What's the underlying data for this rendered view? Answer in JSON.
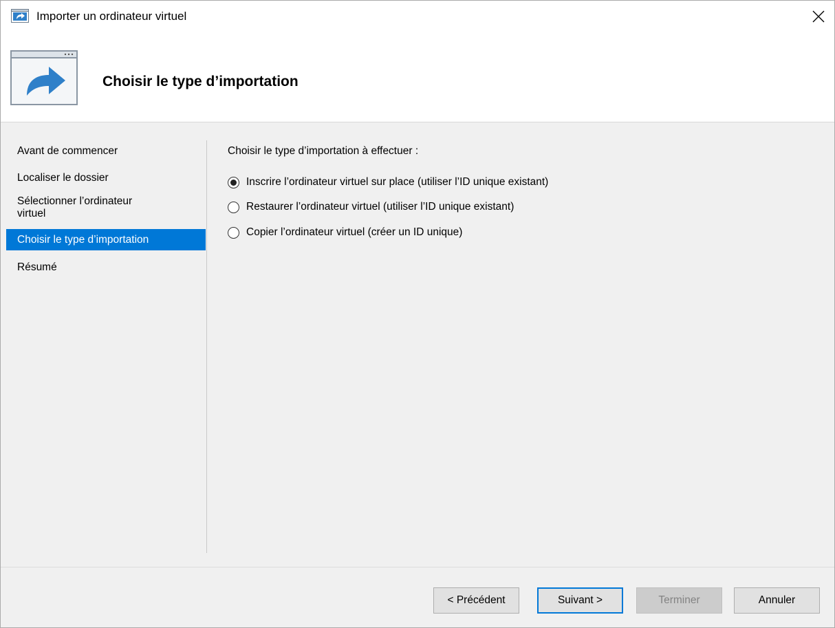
{
  "window": {
    "title": "Importer un ordinateur virtuel",
    "icon": "import-arrow-icon",
    "close_icon": "close-icon"
  },
  "header": {
    "title": "Choisir le type d’importation",
    "icon": "import-wizard-icon"
  },
  "nav": {
    "items": [
      {
        "label": "Avant de commencer",
        "active": false
      },
      {
        "label": "Localiser le dossier",
        "active": false
      },
      {
        "label_line1": "Sélectionner l’ordinateur",
        "label_line2": "virtuel",
        "active": false
      },
      {
        "label": "Choisir le type d’importation",
        "active": true
      },
      {
        "label": "Résumé",
        "active": false
      }
    ]
  },
  "content": {
    "prompt": "Choisir le type d’importation à effectuer :",
    "options": [
      {
        "label": "Inscrire l’ordinateur virtuel sur place (utiliser l’ID unique existant)",
        "selected": true
      },
      {
        "label": "Restaurer l’ordinateur virtuel (utiliser l’ID unique existant)",
        "selected": false
      },
      {
        "label": "Copier l’ordinateur virtuel (créer un ID unique)",
        "selected": false
      }
    ]
  },
  "buttons": {
    "previous": "< Précédent",
    "next": "Suivant >",
    "finish": "Terminer",
    "cancel": "Annuler"
  },
  "colors": {
    "accent": "#0078d7",
    "disabled_bg": "#cccccc",
    "disabled_text": "#838383"
  }
}
